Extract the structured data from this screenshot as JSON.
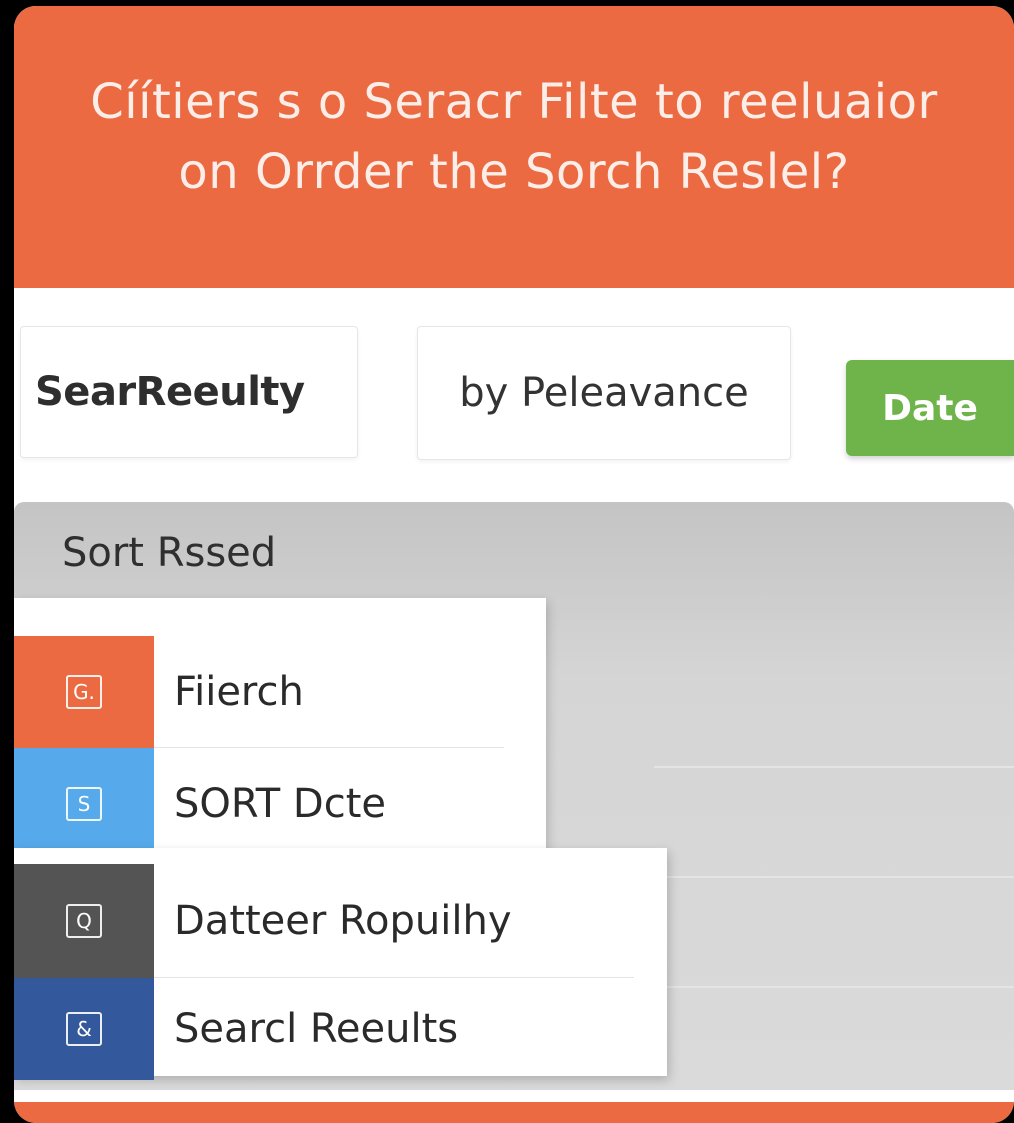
{
  "header": {
    "title_line1": "Cíítiers s o Seracr Filte to reeluaior",
    "title_line2": "on Orrder the Sorch Reslel?"
  },
  "controls": {
    "search_label": "SearReeulty",
    "relevance_label": "by Peleavance",
    "date_button": "Date"
  },
  "panel": {
    "title": "Sort Rssed"
  },
  "menu": {
    "items": [
      {
        "label": "Fiierch",
        "icon": "gear-icon",
        "glyph": "G.",
        "color": "#ec6a42"
      },
      {
        "label": "SORT Dcte",
        "icon": "sort-icon",
        "glyph": "S",
        "color": "#56a9ea"
      },
      {
        "label": "Datteer Ropuilhy",
        "icon": "badge-icon",
        "glyph": "Q",
        "color": "#545454"
      },
      {
        "label": "Searcl Reeults",
        "icon": "link-icon",
        "glyph": "&",
        "color": "#34589c"
      }
    ]
  },
  "colors": {
    "accent": "#ec6a42",
    "date_button": "#6fb44b"
  }
}
